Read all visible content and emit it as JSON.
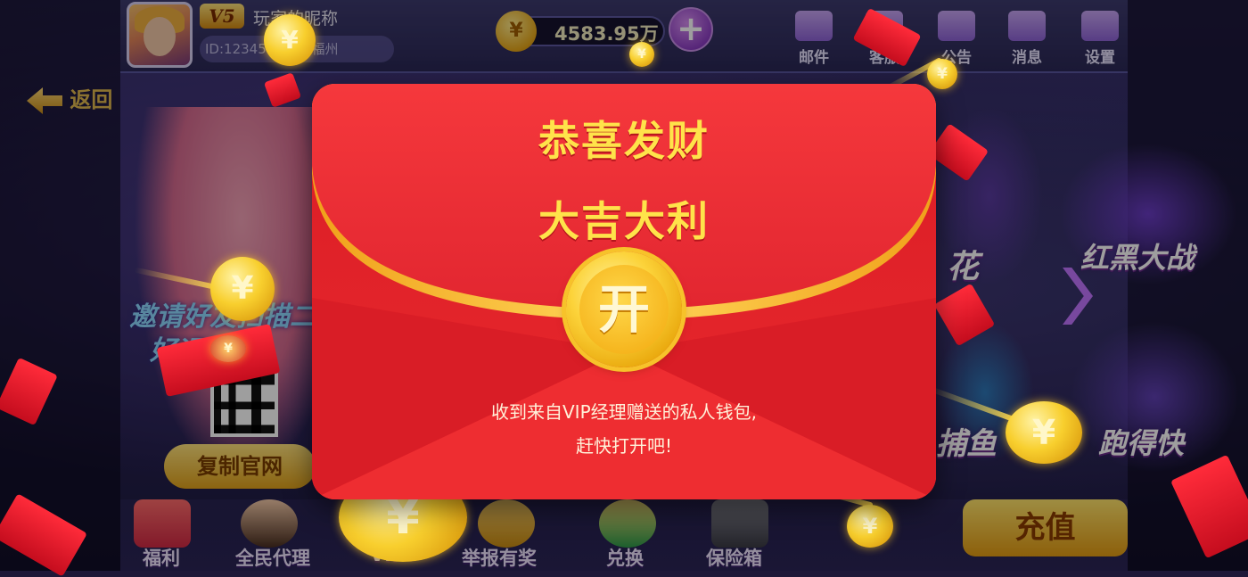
{
  "header": {
    "vip_badge": "V5",
    "nickname": "玩家的昵称",
    "user_id": "ID:12345",
    "location": "福建 福州",
    "coin_symbol": "¥",
    "coin_amount": "4583.95万",
    "add_button": "+",
    "nav": [
      {
        "label": "邮件",
        "icon": "mail-icon"
      },
      {
        "label": "客服",
        "icon": "service-icon"
      },
      {
        "label": "公告",
        "icon": "announcement-icon"
      },
      {
        "label": "消息",
        "icon": "message-icon"
      },
      {
        "label": "设置",
        "icon": "settings-icon"
      }
    ]
  },
  "back_label": "返回",
  "promo": {
    "line1": "邀请好友扫描二",
    "line2": "好运连连",
    "copy_button": "复制官网"
  },
  "games": [
    {
      "label": "红黑大战"
    },
    {
      "label": "花"
    },
    {
      "label": "捕鱼"
    },
    {
      "label": "跑得快"
    }
  ],
  "bottom_nav": [
    {
      "label": "福利"
    },
    {
      "label": "全民代理"
    },
    {
      "label": "VIP"
    },
    {
      "label": "举报有奖"
    },
    {
      "label": "兑换"
    },
    {
      "label": "保险箱"
    }
  ],
  "recharge_label": "充值",
  "red_envelope": {
    "title_line1": "恭喜发财",
    "title_line2": "大吉大利",
    "open_button": "开",
    "message_line1": "收到来自VIP经理赠送的私人钱包,",
    "message_line2": "赶快打开吧!"
  },
  "colors": {
    "envelope_red": "#e8232b",
    "title_yellow": "#ffe34a",
    "coin_gold": "#f8cf2e"
  }
}
